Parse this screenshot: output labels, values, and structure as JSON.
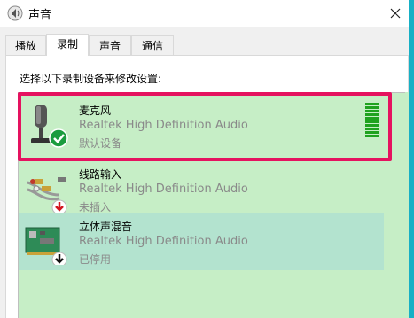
{
  "window": {
    "title": "声音"
  },
  "tabs": [
    {
      "label": "播放",
      "active": false
    },
    {
      "label": "录制",
      "active": true
    },
    {
      "label": "声音",
      "active": false
    },
    {
      "label": "通信",
      "active": false
    }
  ],
  "instruction": "选择以下录制设备来修改设置:",
  "devices": [
    {
      "name": "麦克风",
      "driver": "Realtek High Definition Audio",
      "status": "默认设备",
      "icon": "microphone-icon",
      "badge": "check-icon",
      "level_bars": 10
    },
    {
      "name": "线路输入",
      "driver": "Realtek High Definition Audio",
      "status": "未插入",
      "icon": "line-in-cable-icon",
      "badge": "unplugged-arrow-icon"
    },
    {
      "name": "立体声混音",
      "driver": "Realtek High Definition Audio",
      "status": "已停用",
      "icon": "sound-card-icon",
      "badge": "disabled-arrow-icon"
    }
  ],
  "colors": {
    "selection_frame": "#e5125f",
    "list_bg": "#c6eec6",
    "hover_row": "#b3e3cf",
    "meter": "#1fa21f",
    "accent": "#17b0c5"
  }
}
